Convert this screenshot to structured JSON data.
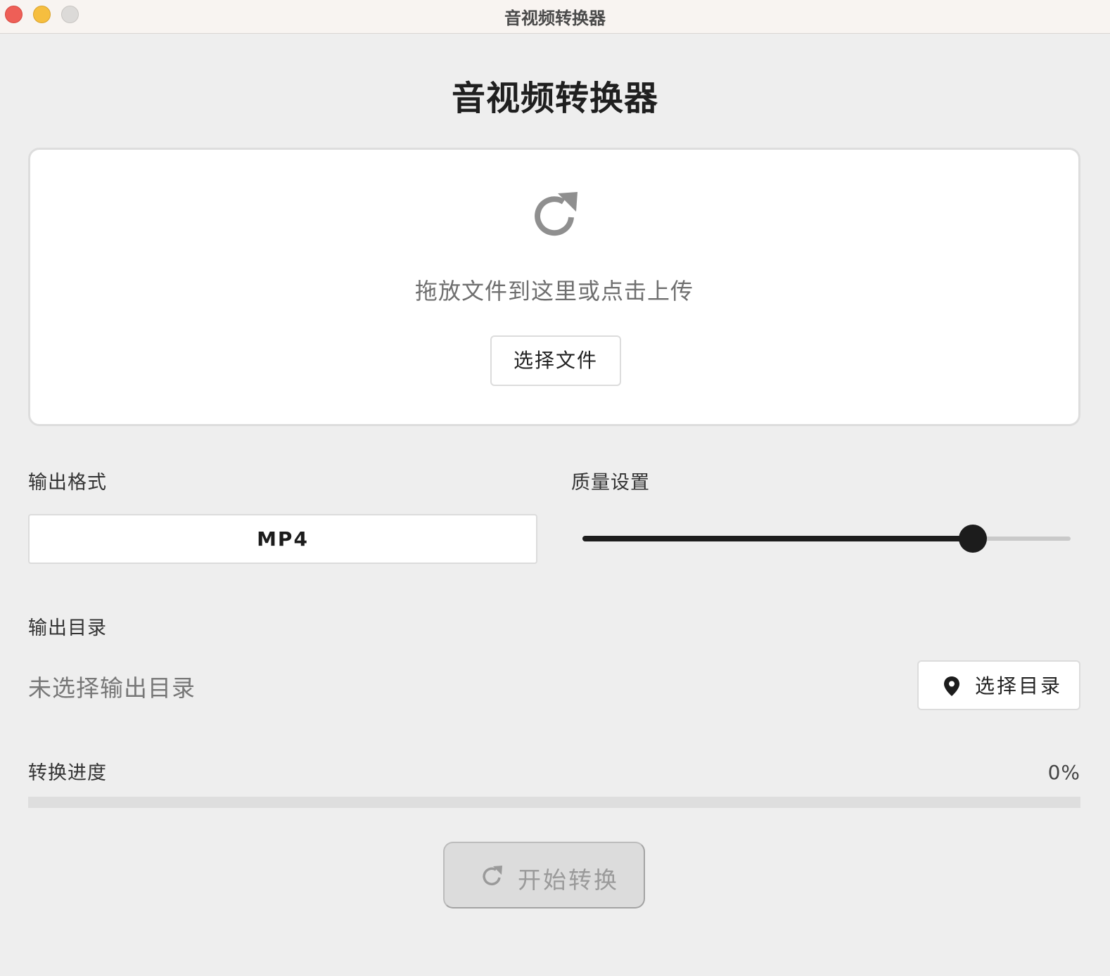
{
  "window": {
    "title": "音视频转换器"
  },
  "page": {
    "title": "音视频转换器"
  },
  "upload": {
    "icon": "refresh-icon",
    "hint": "拖放文件到这里或点击上传",
    "button_label": "选择文件"
  },
  "format": {
    "label": "输出格式",
    "value": "MP4"
  },
  "quality": {
    "label": "质量设置",
    "level_fraction": 0.8
  },
  "output_dir": {
    "label": "输出目录",
    "value": "未选择输出目录",
    "button_icon": "location-pin-icon",
    "button_label": "选择目录"
  },
  "progress": {
    "label": "转换进度",
    "percent_text": "0%",
    "fraction": 0
  },
  "start": {
    "icon": "refresh-icon",
    "label": "开始转换",
    "disabled": true
  },
  "colors": {
    "background": "#eeeeee",
    "accent": "#1c1c1c",
    "muted_text": "#777777",
    "disabled_button": "#dcdcdc"
  }
}
